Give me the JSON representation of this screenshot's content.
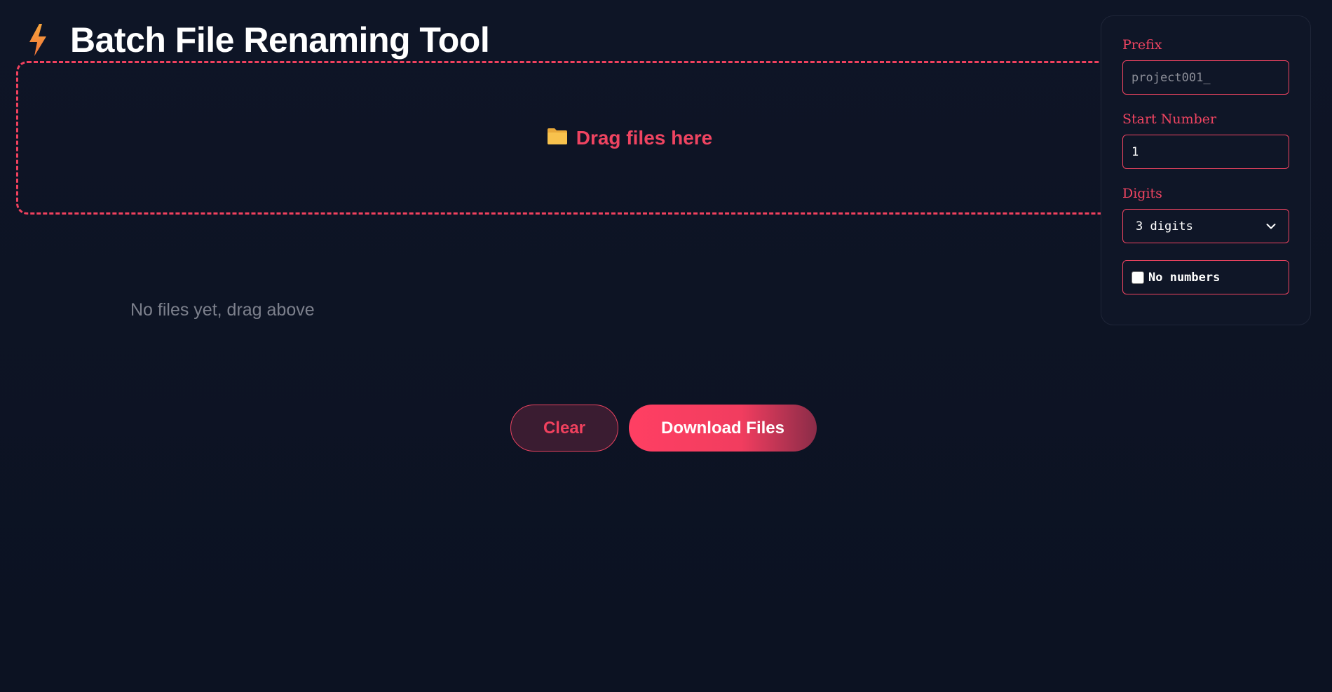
{
  "header": {
    "title": "Batch File Renaming Tool",
    "icon": "bolt-icon"
  },
  "dropzone": {
    "label": "Drag files here",
    "icon": "folder-icon"
  },
  "file_list": {
    "empty_message": "No files yet, drag above"
  },
  "actions": {
    "clear_label": "Clear",
    "download_label": "Download Files"
  },
  "settings": {
    "prefix_label": "Prefix",
    "prefix_placeholder": "project001_",
    "prefix_value": "",
    "start_number_label": "Start Number",
    "start_number_value": "1",
    "digits_label": "Digits",
    "digits_selected": "3 digits",
    "no_numbers_label": "No numbers",
    "no_numbers_checked": false
  },
  "colors": {
    "background": "#0d1425",
    "accent": "#ef4461",
    "bolt": "#f59a3a",
    "folder": "#f7c04a",
    "muted_text": "#7c808c"
  }
}
